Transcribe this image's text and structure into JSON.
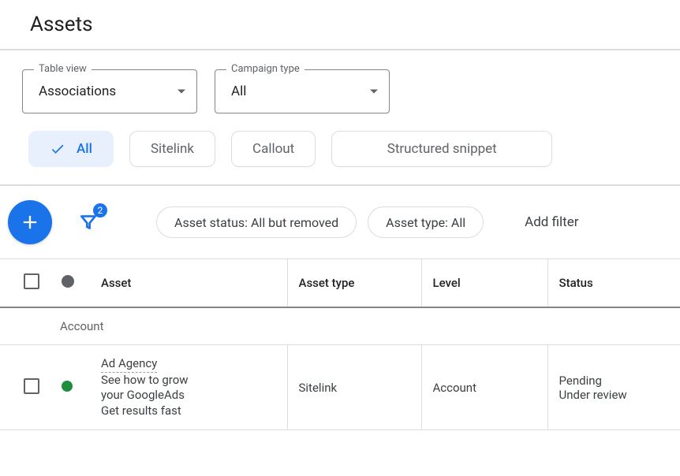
{
  "header": {
    "title": "Assets"
  },
  "table_view": {
    "label": "Table view",
    "value": "Associations"
  },
  "campaign_type": {
    "label": "Campaign type",
    "value": "All"
  },
  "asset_type_chips": {
    "all": "All",
    "sitelink": "Sitelink",
    "callout": "Callout",
    "structured": "Structured snippet"
  },
  "toolbar": {
    "filter_badge": "2",
    "pill_status": "Asset status: All but removed",
    "pill_type": "Asset type: All",
    "add_filter": "Add filter"
  },
  "columns": {
    "asset": "Asset",
    "asset_type": "Asset type",
    "level": "Level",
    "status": "Status"
  },
  "group": {
    "label": "Account"
  },
  "rows": [
    {
      "title": "Ad Agency",
      "line2": "See how to grow",
      "line3": "your GoogleAds",
      "line4": "Get results fast",
      "type": "Sitelink",
      "level": "Account",
      "status1": "Pending",
      "status2": "Under review"
    }
  ]
}
